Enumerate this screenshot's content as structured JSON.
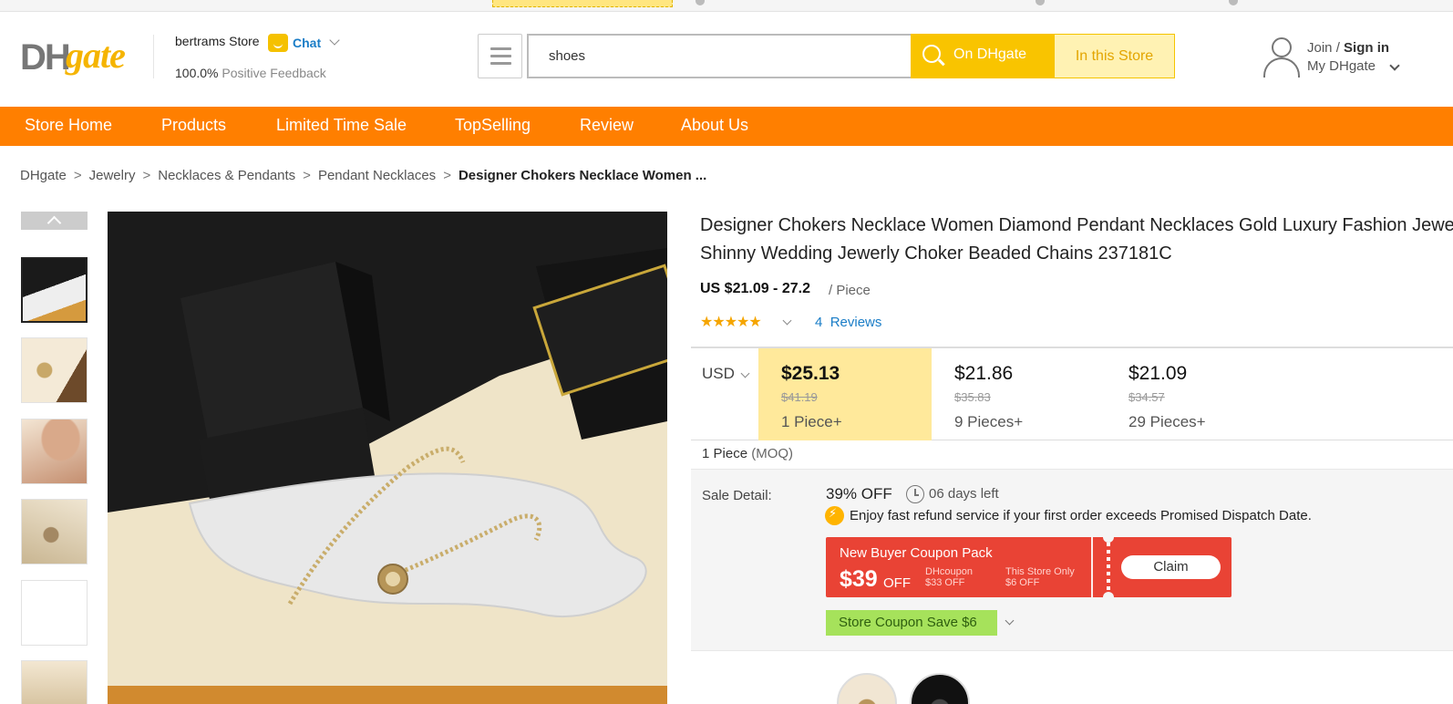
{
  "header": {
    "logo_text_dh": "DH",
    "logo_text_gate": "gate",
    "store_name": "bertrams Store",
    "chat_label": "Chat",
    "feedback_percent": "100.0%",
    "feedback_label": "Positive Feedback",
    "search_value": "shoes",
    "search_placeholder": "",
    "btn_on_dhgate": "On DHgate",
    "btn_in_store": "In this Store",
    "join": "Join",
    "slash": " / ",
    "sign_in": "Sign in",
    "my_dhgate": "My DHgate"
  },
  "nav": {
    "items": [
      {
        "label": "Store Home"
      },
      {
        "label": "Products"
      },
      {
        "label": "Limited Time Sale"
      },
      {
        "label": "TopSelling"
      },
      {
        "label": "Review"
      },
      {
        "label": "About Us"
      }
    ]
  },
  "breadcrumb": {
    "items": [
      "DHgate",
      "Jewelry",
      "Necklaces & Pendants",
      "Pendant Necklaces"
    ],
    "separator": ">",
    "current": "Designer Chokers Necklace Women ..."
  },
  "product": {
    "title_line1": "Designer Chokers Necklace Women Diamond Pendant Necklaces Gold Luxury Fashion Jewelry",
    "title_line2": "Shinny Wedding Jewerly Choker Beaded Chains 237181C",
    "price_range": "US $21.09 - 27.2",
    "unit": "/ Piece",
    "rating_stars": 5,
    "stars_text": "★★★★★",
    "review_count": "4",
    "review_label": "Reviews",
    "currency": "USD",
    "tiers": [
      {
        "price": "$25.13",
        "original": "$41.19",
        "qty": "1 Piece+",
        "active": true
      },
      {
        "price": "$21.86",
        "original": "$35.83",
        "qty": "9 Pieces+",
        "active": false
      },
      {
        "price": "$21.09",
        "original": "$34.57",
        "qty": "29 Pieces+",
        "active": false
      }
    ],
    "moq_qty": "1 Piece",
    "moq_label": "(MOQ)"
  },
  "sale": {
    "label": "Sale Detail:",
    "off": "39% OFF",
    "days_left": "06 days left",
    "refund_text": "Enjoy fast refund service if your first order exceeds Promised Dispatch Date.",
    "coupon_title": "New Buyer Coupon Pack",
    "coupon_amount": "$39",
    "coupon_off": "OFF",
    "coupon_d1_label": "DHcoupon",
    "coupon_d1_value": "$33 OFF",
    "coupon_d2_label": "This Store Only",
    "coupon_d2_value": "$6 OFF",
    "claim": "Claim",
    "store_coupon": "Store Coupon Save $6"
  },
  "colors": {
    "nav_orange": "#ff7f00",
    "search_yellow": "#f9c400",
    "active_tier": "#ffe99b",
    "coupon_red": "#e94335",
    "store_coupon_green": "#a6e25b",
    "link_blue": "#1a7dc7"
  }
}
